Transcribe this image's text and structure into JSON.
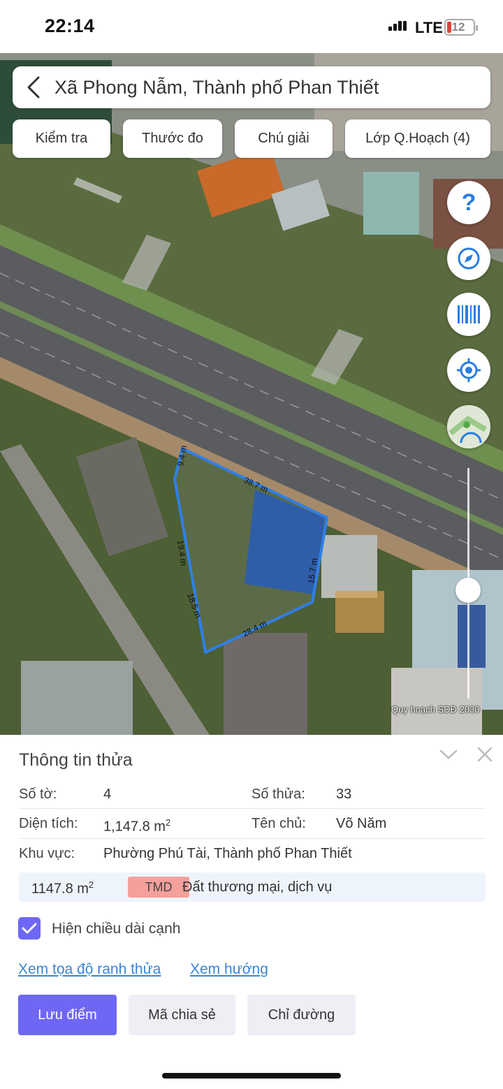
{
  "status_bar": {
    "time": "22:14",
    "network": "LTE",
    "battery": "12",
    "battery_color": "#e5413a"
  },
  "header": {
    "title": "Xã Phong Nẫm, Thành phố Phan Thiết",
    "back_icon": "chevron-left-icon"
  },
  "toolbar": {
    "check": "Kiểm tra",
    "measure": "Thước đo",
    "legend": "Chú giải",
    "layers": "Lớp Q.Hoạch (4)"
  },
  "map_controls": {
    "help_icon": "question-icon",
    "compass_icon": "compass-icon",
    "barcode_icon": "barcode-icon",
    "locate_icon": "locate-icon",
    "layer_thumb_icon": "map-layer-icon"
  },
  "parcel": {
    "edges": [
      "9.4 m",
      "38.7 m",
      "19.4 m",
      "15.7 m",
      "18.5 m",
      "28.4 m"
    ],
    "outline_color": "#2f7fe8"
  },
  "map_caption": "Quy hoạch SDĐ 2030",
  "info": {
    "title": "Thông tin thửa",
    "sheet_label": "Số tờ:",
    "sheet_value": "4",
    "parcel_label": "Số thửa:",
    "parcel_value": "33",
    "area_label": "Diện tích:",
    "area_value": "1,147.8 m",
    "area_unit_sup": "2",
    "owner_label": "Tên chủ:",
    "owner_value": "Võ Năm",
    "region_label": "Khu vực:",
    "region_value": "Phường Phú Tài, Thành phố Phan Thiết"
  },
  "land_use": {
    "area": "1147.8 m",
    "area_sup": "2",
    "code": "TMD",
    "type": "Đất thương mại, dịch vụ",
    "badge_color": "#f4a09b"
  },
  "show_edges": {
    "label": "Hiện chiều dài cạnh",
    "checked": true
  },
  "links": {
    "coords": "Xem tọa độ ranh thửa",
    "direction": "Xem hướng"
  },
  "actions": {
    "save": "Lưu điểm",
    "share": "Mã chia sẻ",
    "route": "Chỉ đường"
  },
  "accent_color": "#6e67f5"
}
